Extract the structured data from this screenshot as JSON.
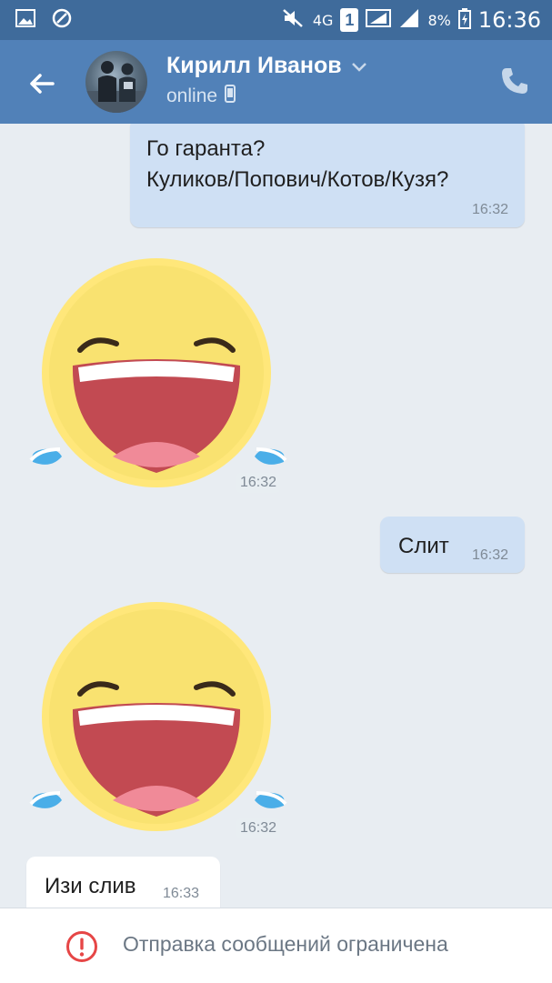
{
  "status_bar": {
    "network": "4G",
    "sim": "1",
    "battery": "8%",
    "time": "16:36"
  },
  "header": {
    "name": "Кирилл Иванов",
    "status": "online"
  },
  "messages": [
    {
      "type": "text",
      "direction": "out",
      "lines": [
        "Го гаранта?",
        "Куликов/Попович/Котов/Кузя?"
      ],
      "time": "16:32"
    },
    {
      "type": "sticker",
      "direction": "in",
      "sticker": "laughing-tears-emoji",
      "time": "16:32"
    },
    {
      "type": "text",
      "direction": "out",
      "lines": [
        "Слит"
      ],
      "time": "16:32"
    },
    {
      "type": "sticker",
      "direction": "in",
      "sticker": "laughing-tears-emoji",
      "time": "16:32"
    },
    {
      "type": "text",
      "direction": "in",
      "lines": [
        "Изи слив"
      ],
      "time": "16:33"
    }
  ],
  "footer": {
    "notice": "Отправка сообщений ограничена"
  },
  "colors": {
    "status_bar": "#3f6b9b",
    "header": "#5181b8",
    "chat_bg": "#e8edf2",
    "outgoing_bubble": "#cfe0f4",
    "incoming_bubble": "#ffffff",
    "warning": "#e64646"
  }
}
